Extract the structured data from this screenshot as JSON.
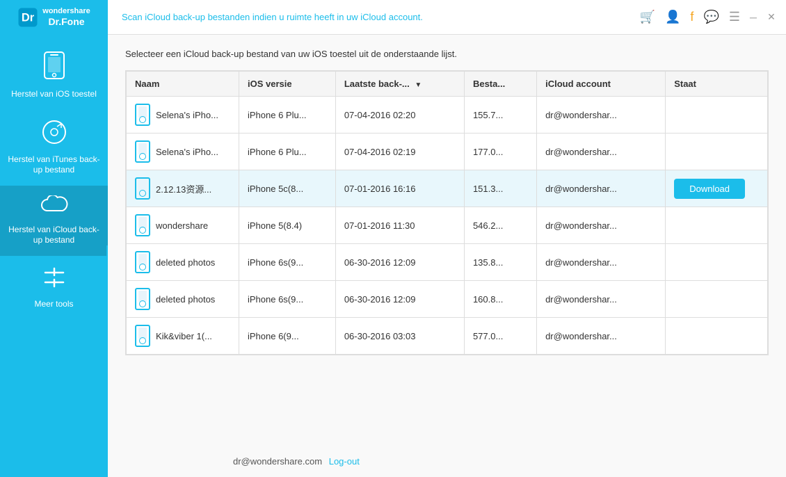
{
  "app": {
    "title": "Dr.Fone",
    "subtitle": "Wondershare",
    "header_message": "Scan iCloud back-up bestanden indien u ruimte heeft in uw iCloud account."
  },
  "sidebar": {
    "items": [
      {
        "id": "ios-restore",
        "label": "Herstel van iOS toestel",
        "icon": "📱"
      },
      {
        "id": "itunes-restore",
        "label": "Herstel van iTunes back-up bestand",
        "icon": "🎵"
      },
      {
        "id": "icloud-restore",
        "label": "Herstel van iCloud back-up bestand",
        "icon": "☁️",
        "active": true
      },
      {
        "id": "more-tools",
        "label": "Meer tools",
        "icon": "🔧"
      }
    ]
  },
  "main": {
    "instruction": "Selecteer een iCloud back-up bestand van uw iOS toestel uit de onderstaande lijst.",
    "table": {
      "columns": [
        {
          "id": "naam",
          "label": "Naam"
        },
        {
          "id": "ios",
          "label": "iOS versie"
        },
        {
          "id": "backup",
          "label": "Laatste back-...",
          "sortable": true
        },
        {
          "id": "bestand",
          "label": "Besta..."
        },
        {
          "id": "account",
          "label": "iCloud account"
        },
        {
          "id": "staat",
          "label": "Staat"
        }
      ],
      "rows": [
        {
          "naam": "Selena's iPho...",
          "ios": "iPhone 6 Plu...",
          "backup": "07-04-2016 02:20",
          "bestand": "155.7...",
          "account": "dr@wondershar...",
          "staat": "",
          "highlighted": false
        },
        {
          "naam": "Selena's iPho...",
          "ios": "iPhone 6 Plu...",
          "backup": "07-04-2016 02:19",
          "bestand": "177.0...",
          "account": "dr@wondershar...",
          "staat": "",
          "highlighted": false
        },
        {
          "naam": "2.12.13资源...",
          "ios": "iPhone 5c(8...",
          "backup": "07-01-2016 16:16",
          "bestand": "151.3...",
          "account": "dr@wondershar...",
          "staat": "Download",
          "highlighted": true
        },
        {
          "naam": "wondershare",
          "ios": "iPhone 5(8.4)",
          "backup": "07-01-2016 11:30",
          "bestand": "546.2...",
          "account": "dr@wondershar...",
          "staat": "",
          "highlighted": false
        },
        {
          "naam": "deleted photos",
          "ios": "iPhone 6s(9...",
          "backup": "06-30-2016 12:09",
          "bestand": "135.8...",
          "account": "dr@wondershar...",
          "staat": "",
          "highlighted": false
        },
        {
          "naam": "deleted photos",
          "ios": "iPhone 6s(9...",
          "backup": "06-30-2016 12:09",
          "bestand": "160.8...",
          "account": "dr@wondershar...",
          "staat": "",
          "highlighted": false
        },
        {
          "naam": "Kik&viber 1(...",
          "ios": "iPhone 6(9...",
          "backup": "06-30-2016 03:03",
          "bestand": "577.0...",
          "account": "dr@wondershar...",
          "staat": "",
          "highlighted": false
        }
      ]
    }
  },
  "footer": {
    "account": "dr@wondershare.com",
    "logout_label": "Log-out"
  }
}
